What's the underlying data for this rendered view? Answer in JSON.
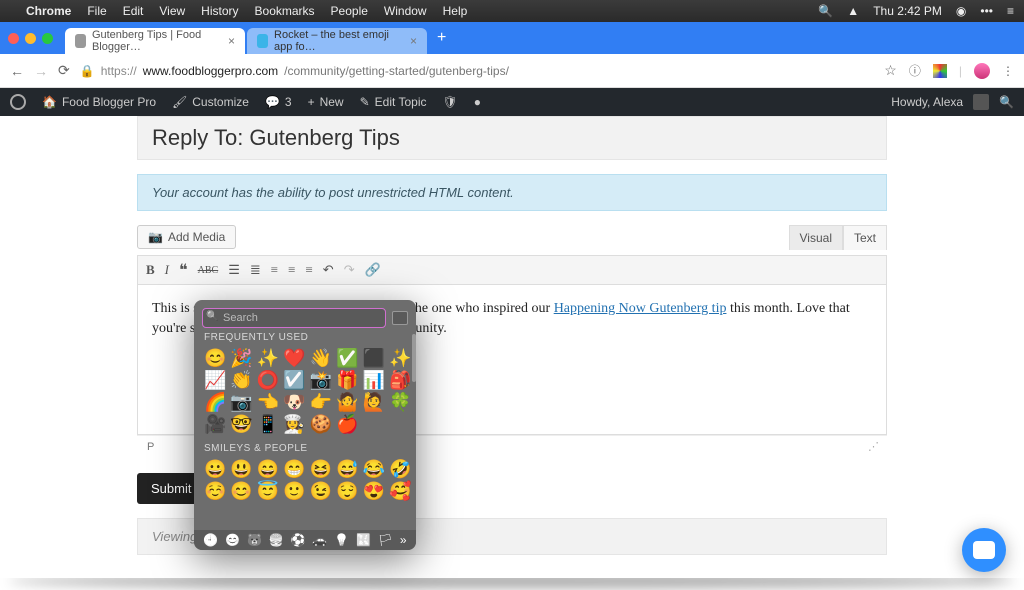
{
  "menubar": {
    "app": "Chrome",
    "items": [
      "File",
      "Edit",
      "View",
      "History",
      "Bookmarks",
      "People",
      "Window",
      "Help"
    ],
    "clock": "Thu 2:42 PM"
  },
  "browser": {
    "tabs": [
      {
        "title": "Gutenberg Tips | Food Blogger…"
      },
      {
        "title": "Rocket – the best emoji app fo…"
      }
    ],
    "url_scheme": "https://",
    "url_host": "www.foodbloggerpro.com",
    "url_path": "/community/getting-started/gutenberg-tips/"
  },
  "wpbar": {
    "site": "Food Blogger Pro",
    "customize": "Customize",
    "comment_count": "3",
    "new": "New",
    "edit": "Edit Topic",
    "howdy": "Howdy, Alexa"
  },
  "page": {
    "title": "Reply To: Gutenberg Tips",
    "notice": "Your account has the ability to post unrestricted HTML content.",
    "add_media": "Add Media",
    "editor_tabs": {
      "visual": "Visual",
      "text": "Text"
    },
    "body_before": "This is so so cool, Katie! You must have been the one who inspired our ",
    "body_link": "Happening Now Gutenberg tip",
    "body_after": " this month. Love that you're sharing these quick wins with the community.",
    "path": "P",
    "submit": "Submit R",
    "viewing": "Viewing 1 p"
  },
  "picker": {
    "search_placeholder": "Search",
    "section_frequent": "FREQUENTLY USED",
    "section_smileys": "SMILEYS & PEOPLE",
    "frequent": [
      "😊",
      "🎉",
      "✨",
      "❤️",
      "👋",
      "✅",
      "⬛",
      "✨",
      "📈",
      "👏",
      "⭕",
      "☑️",
      "📸",
      "🎁",
      "📊",
      "🎒",
      "🌈",
      "📷",
      "👈",
      "🐶",
      "👉",
      "🤷",
      "🙋",
      "🍀",
      "🎥",
      "🤓",
      "📱",
      "👩‍🍳",
      "🍪",
      "🍎"
    ],
    "smileys": [
      "😀",
      "😃",
      "😄",
      "😁",
      "😆",
      "😅",
      "😂",
      "🤣",
      "☺️",
      "😊",
      "😇",
      "🙂",
      "😉",
      "😌",
      "😍",
      "🥰"
    ]
  }
}
